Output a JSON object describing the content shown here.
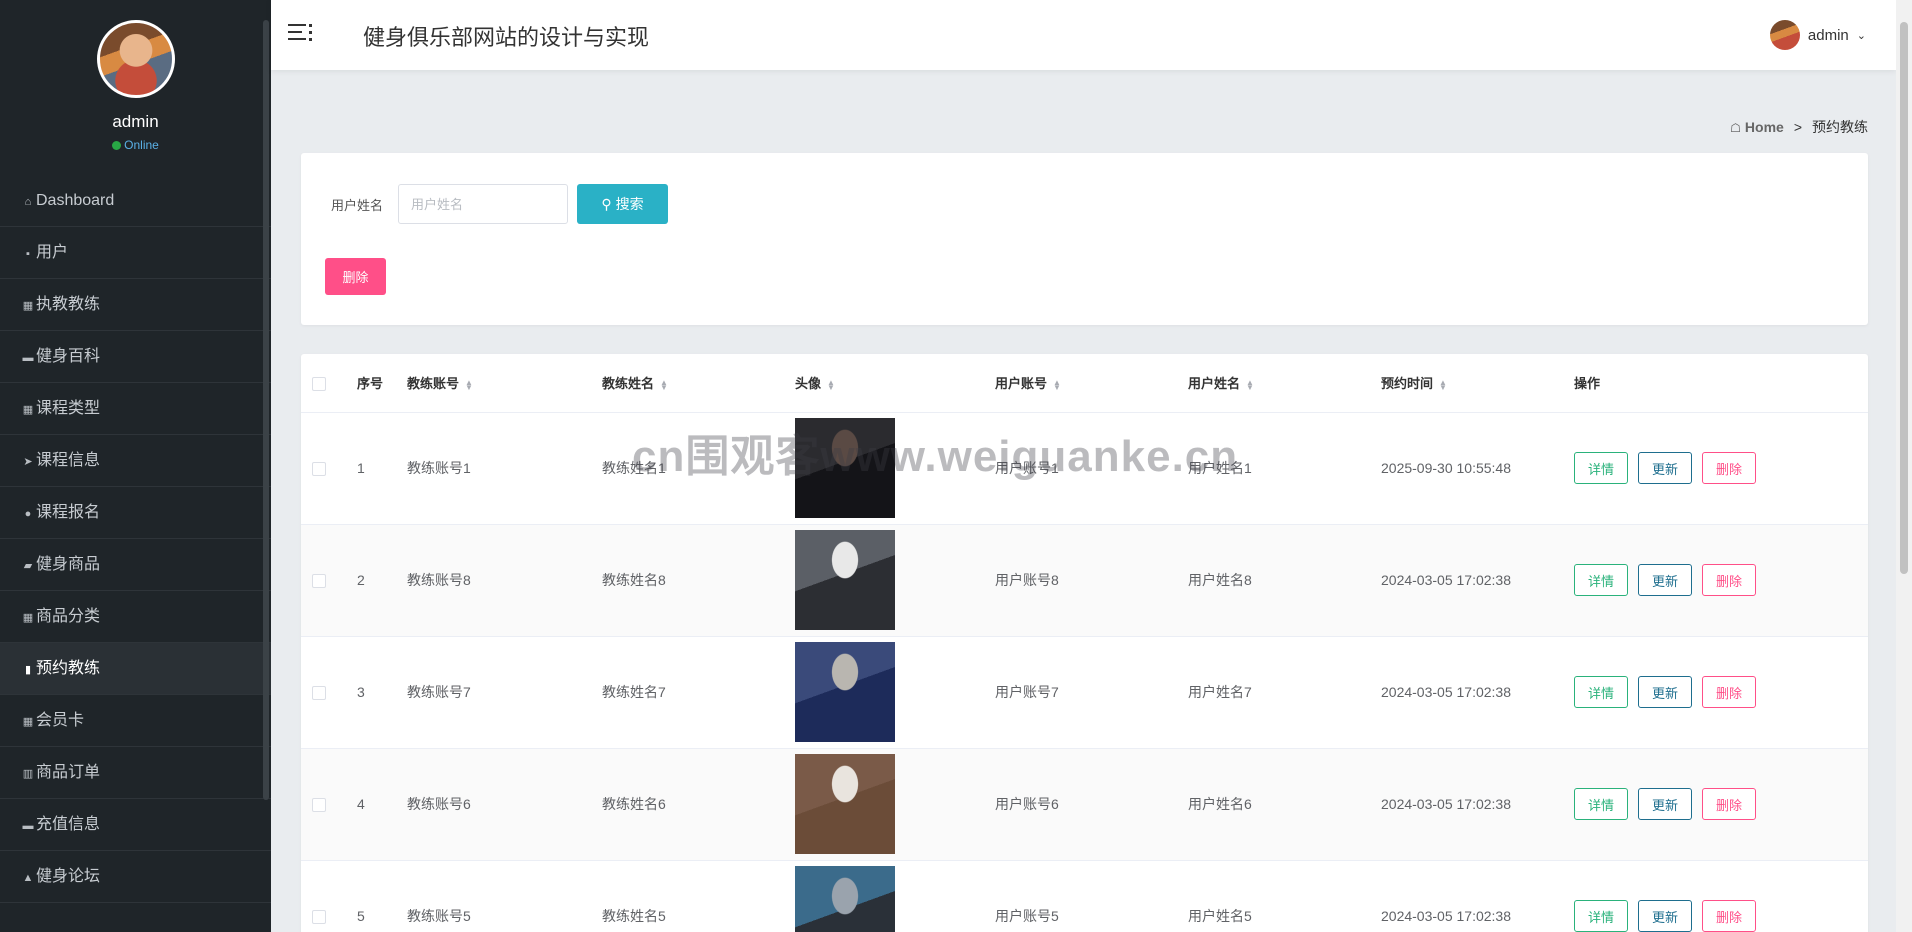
{
  "sidebar": {
    "user": {
      "name": "admin",
      "status": "Online"
    },
    "items": [
      {
        "label": "Dashboard",
        "icon": "home-icon",
        "glyph": "⌂"
      },
      {
        "label": "用户",
        "icon": "clipboard-icon",
        "glyph": "▪"
      },
      {
        "label": "执教教练",
        "icon": "grid-icon",
        "glyph": "▦"
      },
      {
        "label": "健身百科",
        "icon": "briefcase-icon",
        "glyph": "▬"
      },
      {
        "label": "课程类型",
        "icon": "grid-icon",
        "glyph": "▦"
      },
      {
        "label": "课程信息",
        "icon": "send-icon",
        "glyph": "➤"
      },
      {
        "label": "课程报名",
        "icon": "map-pin-icon",
        "glyph": "●"
      },
      {
        "label": "健身商品",
        "icon": "camera-icon",
        "glyph": "▰"
      },
      {
        "label": "商品分类",
        "icon": "grid-icon",
        "glyph": "▦"
      },
      {
        "label": "预约教练",
        "icon": "document-icon",
        "glyph": "▮"
      },
      {
        "label": "会员卡",
        "icon": "apps-icon",
        "glyph": "▦"
      },
      {
        "label": "商品订单",
        "icon": "bar-chart-icon",
        "glyph": "▥"
      },
      {
        "label": "充值信息",
        "icon": "comment-icon",
        "glyph": "▬"
      },
      {
        "label": "健身论坛",
        "icon": "user-icon",
        "glyph": "▲"
      }
    ],
    "active_index": 9
  },
  "header": {
    "title": "健身俱乐部网站的设计与实现",
    "user_name": "admin"
  },
  "breadcrumb": {
    "home": "Home",
    "separator": ">",
    "current": "预约教练"
  },
  "search": {
    "label": "用户姓名",
    "placeholder": "用户姓名",
    "value": "",
    "button_label": "搜索",
    "delete_label": "删除"
  },
  "table": {
    "columns": [
      "序号",
      "教练账号",
      "教练姓名",
      "头像",
      "用户账号",
      "用户姓名",
      "预约时间",
      "操作"
    ],
    "actions": {
      "detail": "详情",
      "update": "更新",
      "delete": "删除"
    },
    "rows": [
      {
        "index": "1",
        "coach_account": "教练账号1",
        "coach_name": "教练姓名1",
        "user_account": "用户账号1",
        "user_name": "用户姓名1",
        "time": "2025-09-30 10:55:48",
        "img_colors": [
          "#2b2b2f",
          "#5a4a44",
          "#141418"
        ]
      },
      {
        "index": "2",
        "coach_account": "教练账号8",
        "coach_name": "教练姓名8",
        "user_account": "用户账号8",
        "user_name": "用户姓名8",
        "time": "2024-03-05 17:02:38",
        "img_colors": [
          "#5b5f66",
          "#e8e8e8",
          "#2c2e33"
        ]
      },
      {
        "index": "3",
        "coach_account": "教练账号7",
        "coach_name": "教练姓名7",
        "user_account": "用户账号7",
        "user_name": "用户姓名7",
        "time": "2024-03-05 17:02:38",
        "img_colors": [
          "#3a4a7a",
          "#b9b6b0",
          "#1d2b5a"
        ]
      },
      {
        "index": "4",
        "coach_account": "教练账号6",
        "coach_name": "教练姓名6",
        "user_account": "用户账号6",
        "user_name": "用户姓名6",
        "time": "2024-03-05 17:02:38",
        "img_colors": [
          "#7a5a48",
          "#e9e4de",
          "#6b4c38"
        ]
      },
      {
        "index": "5",
        "coach_account": "教练账号5",
        "coach_name": "教练姓名5",
        "user_account": "用户账号5",
        "user_name": "用户姓名5",
        "time": "2024-03-05 17:02:38",
        "img_colors": [
          "#3b6b8b",
          "#9aa3ad",
          "#2a3038"
        ]
      }
    ]
  },
  "watermark": "cn围观客www.weiguanke.cn",
  "colors": {
    "sidebar_bg": "#1f2529",
    "search_button": "#2ab1c6",
    "delete_button": "#ff4f88",
    "detail_button": "#2ab27b",
    "update_button": "#1e6e8e"
  }
}
